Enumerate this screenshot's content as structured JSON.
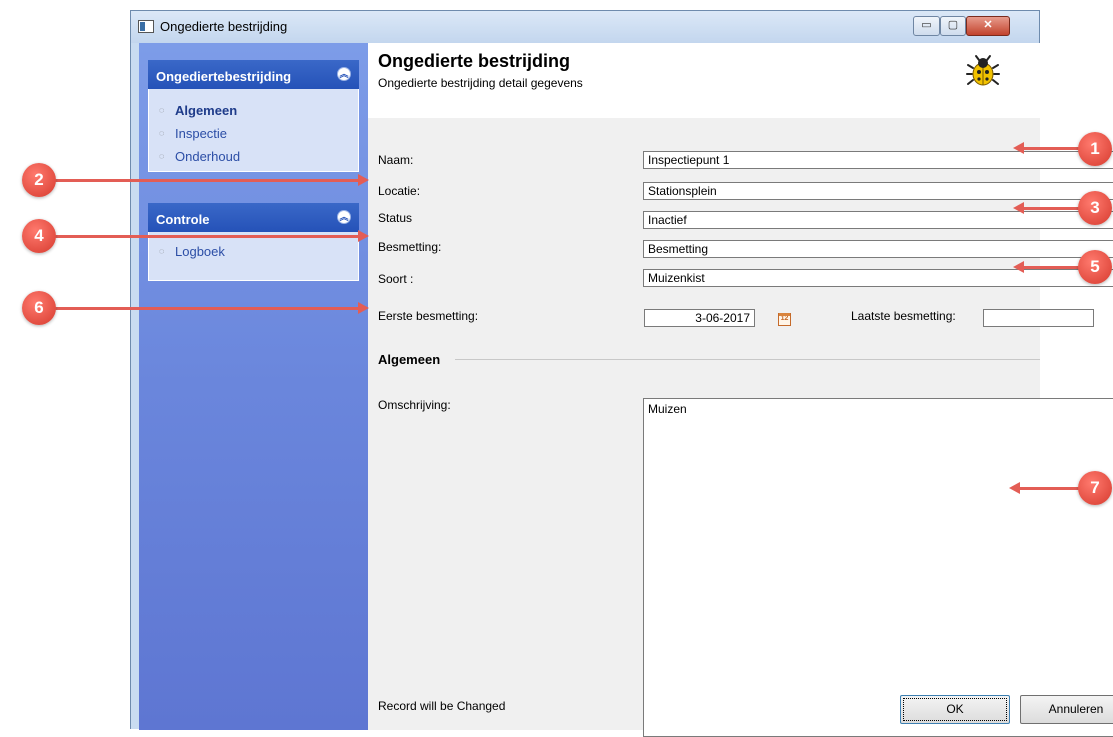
{
  "window": {
    "title": "Ongedierte bestrijding",
    "min_glyph": "▭",
    "max_glyph": "▢",
    "close_glyph": "✕"
  },
  "sidebar": {
    "groups": [
      {
        "header": "Ongediertebestrijding",
        "items": [
          {
            "label": "Algemeen",
            "active": true
          },
          {
            "label": "Inspectie"
          },
          {
            "label": "Onderhoud"
          }
        ]
      },
      {
        "header": "Controle",
        "items": [
          {
            "label": "Logboek"
          }
        ]
      }
    ]
  },
  "header": {
    "title": "Ongedierte bestrijding",
    "subtitle": "Ongedierte bestrijding detail gegevens",
    "icon": "bug-icon"
  },
  "form": {
    "naam": {
      "label": "Naam:",
      "value": "Inspectiepunt 1"
    },
    "locatie": {
      "label": "Locatie:",
      "value": "Stationsplein"
    },
    "status": {
      "label": "Status",
      "value": "Inactief"
    },
    "besmetting": {
      "label": "Besmetting:",
      "value": "Besmetting"
    },
    "soort": {
      "label": "Soort :",
      "value": "Muizenkist"
    },
    "eerste_besmetting": {
      "label": "Eerste besmetting:",
      "value": "3-06-2017"
    },
    "laatste_besmetting": {
      "label": "Laatste besmetting:",
      "value": ""
    },
    "section_title": "Algemeen",
    "omschrijving": {
      "label": "Omschrijving:",
      "value": "Muizen"
    }
  },
  "footer": {
    "status_text": "Record will be Changed",
    "ok_label": "OK",
    "cancel_label": "Annuleren"
  },
  "callouts": [
    "1",
    "2",
    "3",
    "4",
    "5",
    "6",
    "7"
  ],
  "colors": {
    "callout": "#e35d55",
    "sidebar_header": "#2552b8",
    "sidebar_bg": "#6a86dc"
  }
}
